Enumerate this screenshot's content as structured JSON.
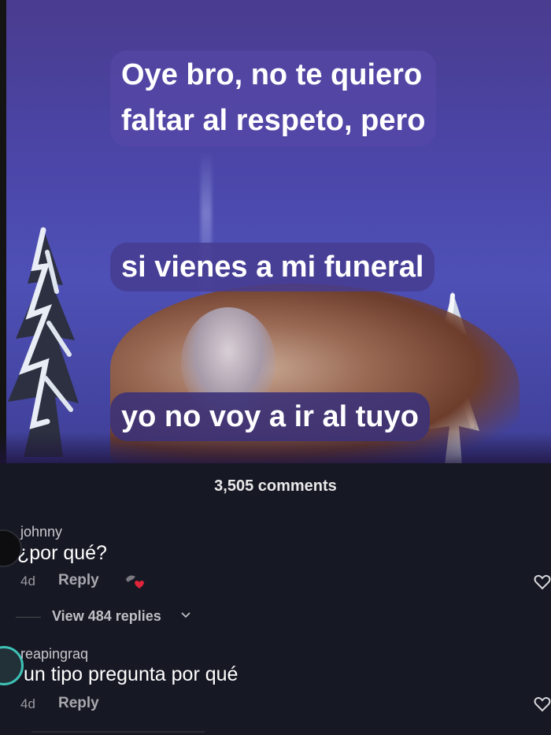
{
  "video": {
    "captions": [
      "Oye bro, no te quiero",
      "faltar al respeto, pero",
      "si vienes a mi funeral",
      "yo no voy a ir al tuyo"
    ]
  },
  "comments_header": {
    "count_label": "3,505 comments"
  },
  "comments": [
    {
      "username": "johnny",
      "text": "¿por qué?",
      "age": "4d",
      "reply_label": "Reply",
      "reaction_icon": "reaction-sticker-icon",
      "view_replies_label": "View 484 replies"
    },
    {
      "username": "reapingraq",
      "text": "un tipo pregunta por qué",
      "age": "4d",
      "reply_label": "Reply"
    }
  ],
  "colors": {
    "panel_bg": "#161823",
    "caption_bg": "#44388c",
    "avatar_ring": "#3ec1b5"
  }
}
